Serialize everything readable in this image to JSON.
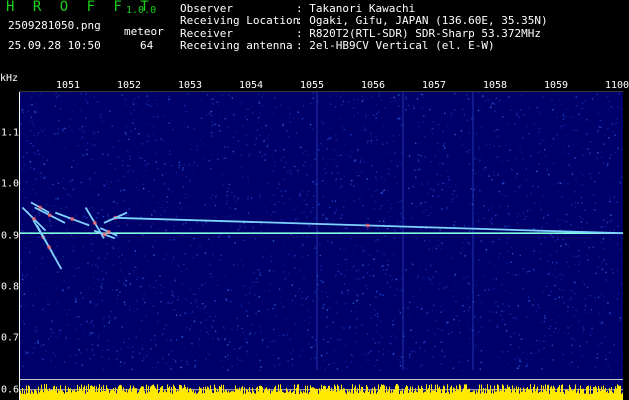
{
  "header": {
    "app_title": "H R O F F T",
    "app_version": "1.0.0",
    "filename": "2509281050.png",
    "timestamp": "25.09.28 10:50",
    "meteor_label": "meteor",
    "meteor_count": "64"
  },
  "station": {
    "rows": [
      {
        "key": "Observer",
        "value": ": Takanori Kawachi"
      },
      {
        "key": "Receiving Location",
        "value": ": Ogaki, Gifu, JAPAN (136.60E, 35.35N)"
      },
      {
        "key": "Receiver",
        "value": ": R820T2(RTL-SDR) SDR-Sharp 53.372MHz"
      },
      {
        "key": "Receiving antenna",
        "value": ": 2el-HB9CV Vertical (el. E-W)"
      }
    ]
  },
  "chart_data": {
    "type": "heatmap",
    "title": "",
    "x_unit_label": "",
    "y_unit_label": "kHz",
    "x_ticks": [
      "1051",
      "1052",
      "1053",
      "1054",
      "1055",
      "1056",
      "1057",
      "1058",
      "1059",
      "1100"
    ],
    "y_ticks": [
      "1.1",
      "1.0",
      "0.9",
      "0.8",
      "0.7",
      "0.6"
    ],
    "ylim": [
      0.58,
      1.18
    ],
    "xlim": [
      1050.5,
      1100.1
    ],
    "carrier_khz": 0.905,
    "meteor_traces": [
      {
        "x": [
          1050.7,
          1052.6
        ],
        "y": [
          0.955,
          0.91
        ]
      },
      {
        "x": [
          1051.4,
          1052.9
        ],
        "y": [
          0.965,
          0.945
        ]
      },
      {
        "x": [
          1051.6,
          1053.2
        ],
        "y": [
          0.93,
          0.865
        ]
      },
      {
        "x": [
          1051.9,
          1053.9
        ],
        "y": [
          0.92,
          0.835
        ]
      },
      {
        "x": [
          1051.7,
          1054.2
        ],
        "y": [
          0.955,
          0.925
        ]
      },
      {
        "x": [
          1055.9,
          1057.4
        ],
        "y": [
          0.955,
          0.895
        ]
      },
      {
        "x": [
          1057.1,
          1058.5
        ],
        "y": [
          0.915,
          0.9
        ]
      },
      {
        "x": [
          1057.4,
          1059.3
        ],
        "y": [
          0.925,
          0.945
        ]
      },
      {
        "x": [
          1058.2,
          1100.0
        ],
        "y": [
          0.935,
          0.905
        ]
      },
      {
        "x": [
          1053.4,
          1056.2
        ],
        "y": [
          0.945,
          0.92
        ]
      },
      {
        "x": [
          1056.6,
          1058.3
        ],
        "y": [
          0.91,
          0.895
        ]
      }
    ],
    "colors": {
      "background": "#00006a",
      "trace": "#7fd4ff",
      "hot": "#ff5a5a",
      "text": "#ffffff",
      "title": "#19d319",
      "carrier": "#80ffe0",
      "band": "#ffe900"
    }
  }
}
